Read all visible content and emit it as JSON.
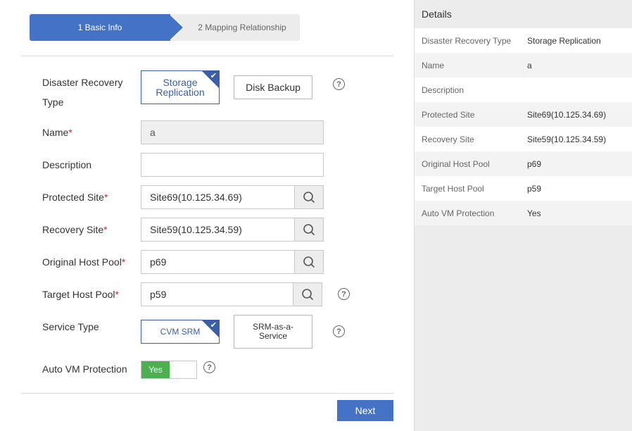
{
  "steps": [
    {
      "label": "1 Basic Info",
      "active": true
    },
    {
      "label": "2 Mapping Relationship",
      "active": false
    }
  ],
  "form": {
    "dr_type": {
      "label": "Disaster Recovery Type",
      "options": [
        {
          "label": "Storage Replication",
          "selected": true
        },
        {
          "label": "Disk Backup",
          "selected": false
        }
      ]
    },
    "name": {
      "label": "Name",
      "required_mark": "*",
      "value": "a"
    },
    "description": {
      "label": "Description",
      "value": ""
    },
    "protected_site": {
      "label": "Protected Site",
      "required_mark": "*",
      "value": "Site69(10.125.34.69)"
    },
    "recovery_site": {
      "label": "Recovery Site",
      "required_mark": "*",
      "value": "Site59(10.125.34.59)"
    },
    "original_host_pool": {
      "label": "Original Host Pool",
      "required_mark": "*",
      "value": "p69"
    },
    "target_host_pool": {
      "label": "Target Host Pool",
      "required_mark": "*",
      "value": "p59"
    },
    "service_type": {
      "label": "Service Type",
      "options": [
        {
          "label": "CVM SRM",
          "selected": true
        },
        {
          "label": "SRM-as-a-Service",
          "selected": false
        }
      ]
    },
    "auto_vm_protection": {
      "label": "Auto VM Protection",
      "value": "Yes",
      "on": true
    }
  },
  "help_glyph": "?",
  "check_glyph": "✔",
  "next_label": "Next",
  "details": {
    "title": "Details",
    "rows": [
      {
        "key": "Disaster Recovery Type",
        "value": "Storage Replication"
      },
      {
        "key": "Name",
        "value": "a"
      },
      {
        "key": "Description",
        "value": ""
      },
      {
        "key": "Protected Site",
        "value": "Site69(10.125.34.69)"
      },
      {
        "key": "Recovery Site",
        "value": "Site59(10.125.34.59)"
      },
      {
        "key": "Original Host Pool",
        "value": "p69"
      },
      {
        "key": "Target Host Pool",
        "value": "p59"
      },
      {
        "key": "Auto VM Protection",
        "value": "Yes"
      }
    ]
  },
  "colors": {
    "accent": "#4472c4",
    "selected_border": "#3a5ea8",
    "toggle_on": "#4caf50",
    "required": "#e02020"
  },
  "icons": {
    "search": "search-icon",
    "help": "help-icon",
    "check": "check-icon"
  }
}
